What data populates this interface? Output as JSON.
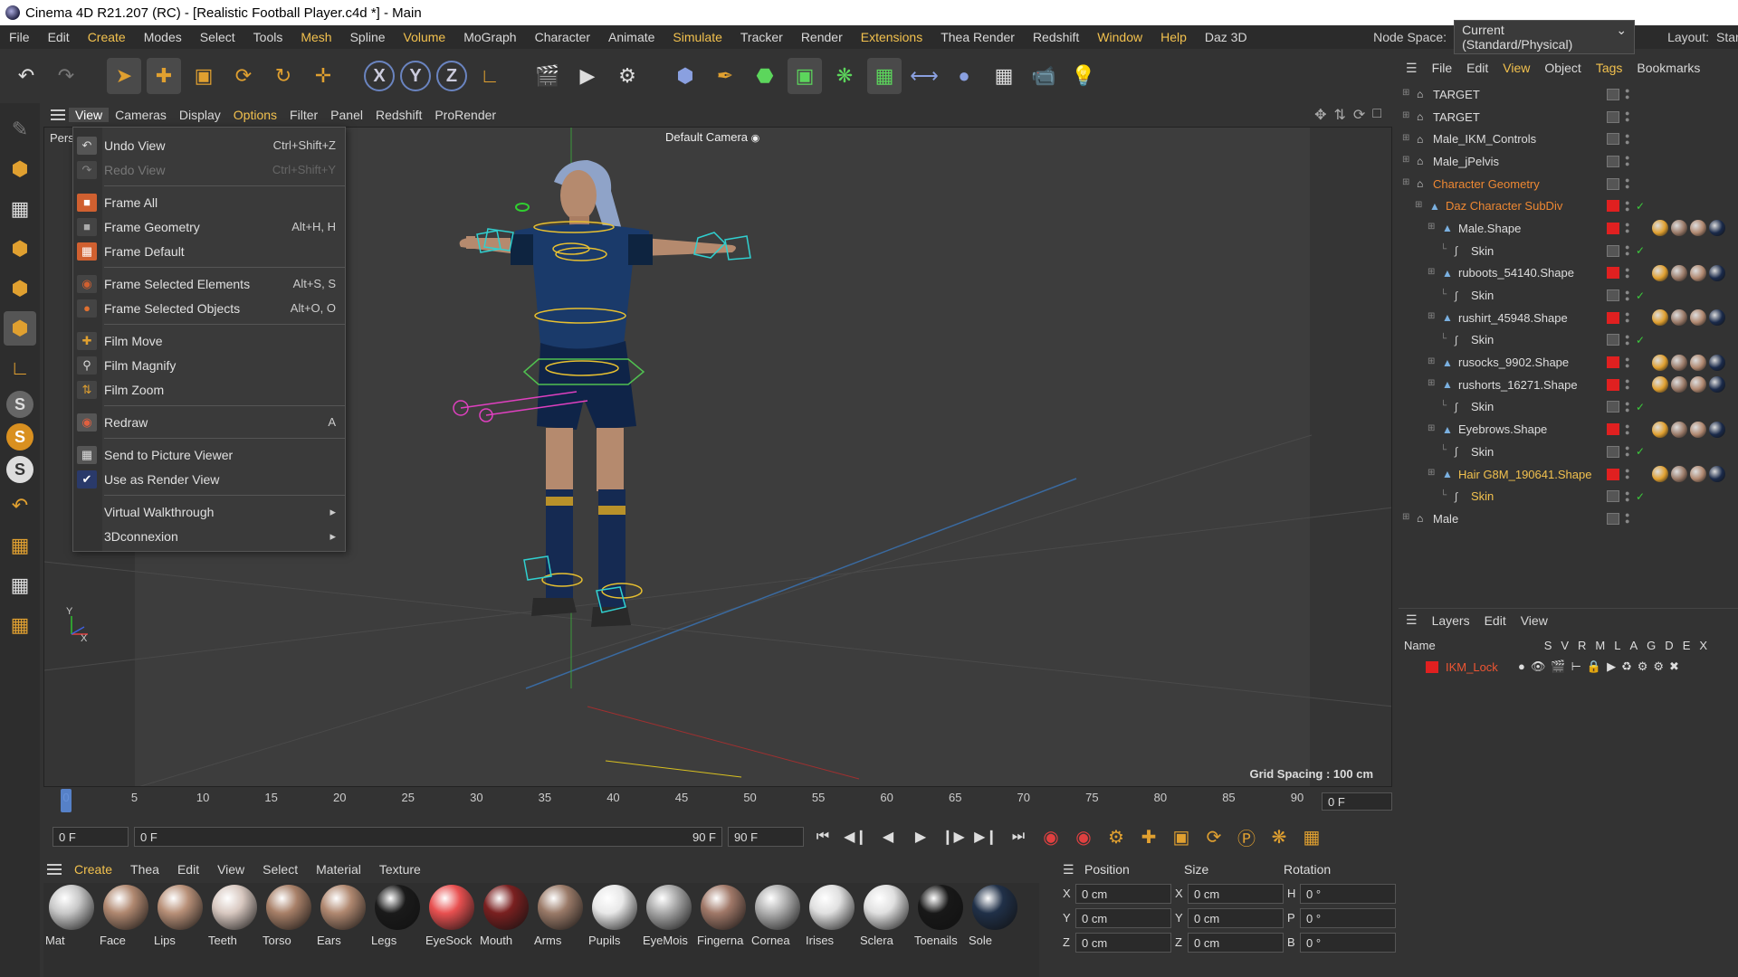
{
  "window": {
    "title": "Cinema 4D R21.207 (RC) - [Realistic Football Player.c4d *] - Main"
  },
  "menubar": {
    "items": [
      {
        "label": "File",
        "hl": false
      },
      {
        "label": "Edit",
        "hl": false
      },
      {
        "label": "Create",
        "hl": true
      },
      {
        "label": "Modes",
        "hl": false
      },
      {
        "label": "Select",
        "hl": false
      },
      {
        "label": "Tools",
        "hl": false
      },
      {
        "label": "Mesh",
        "hl": true
      },
      {
        "label": "Spline",
        "hl": false
      },
      {
        "label": "Volume",
        "hl": true
      },
      {
        "label": "MoGraph",
        "hl": false
      },
      {
        "label": "Character",
        "hl": false
      },
      {
        "label": "Animate",
        "hl": false
      },
      {
        "label": "Simulate",
        "hl": true
      },
      {
        "label": "Tracker",
        "hl": false
      },
      {
        "label": "Render",
        "hl": false
      },
      {
        "label": "Extensions",
        "hl": true
      },
      {
        "label": "Thea Render",
        "hl": false
      },
      {
        "label": "Redshift",
        "hl": false
      },
      {
        "label": "Window",
        "hl": true
      },
      {
        "label": "Help",
        "hl": true
      },
      {
        "label": "Daz 3D",
        "hl": false
      }
    ],
    "node_space_label": "Node Space:",
    "node_space_value": "Current (Standard/Physical)",
    "layout_label": "Layout:",
    "layout_value": "Start"
  },
  "toolbar": {
    "undo_icon": "undo-icon",
    "axis_x": "X",
    "axis_y": "Y",
    "axis_z": "Z"
  },
  "viewport": {
    "menu": [
      {
        "label": "View",
        "active": true
      },
      {
        "label": "Cameras"
      },
      {
        "label": "Display"
      },
      {
        "label": "Options",
        "hl": true
      },
      {
        "label": "Filter"
      },
      {
        "label": "Panel"
      },
      {
        "label": "Redshift"
      },
      {
        "label": "ProRender"
      }
    ],
    "persp_label": "Pers",
    "camera_label": "Default Camera",
    "grid_spacing": "Grid Spacing : 100 cm"
  },
  "view_menu": {
    "items": [
      {
        "label": "Undo View",
        "shortcut": "Ctrl+Shift+Z",
        "icon": "undo-view-icon",
        "disabled": false
      },
      {
        "label": "Redo View",
        "shortcut": "Ctrl+Shift+Y",
        "icon": "redo-view-icon",
        "disabled": true
      },
      {
        "sep": true
      },
      {
        "label": "Frame All",
        "shortcut": "",
        "icon": "frame-all-icon"
      },
      {
        "label": "Frame Geometry",
        "shortcut": "Alt+H, H",
        "icon": "frame-geometry-icon"
      },
      {
        "label": "Frame Default",
        "shortcut": "",
        "icon": "frame-default-icon"
      },
      {
        "sep": true
      },
      {
        "label": "Frame Selected Elements",
        "shortcut": "Alt+S, S",
        "icon": "frame-selected-elements-icon"
      },
      {
        "label": "Frame Selected Objects",
        "shortcut": "Alt+O, O",
        "icon": "frame-selected-objects-icon"
      },
      {
        "sep": true
      },
      {
        "label": "Film Move",
        "shortcut": "",
        "icon": "film-move-icon"
      },
      {
        "label": "Film Magnify",
        "shortcut": "",
        "icon": "film-magnify-icon"
      },
      {
        "label": "Film Zoom",
        "shortcut": "",
        "icon": "film-zoom-icon"
      },
      {
        "sep": true
      },
      {
        "label": "Redraw",
        "shortcut": "A",
        "icon": "redraw-icon"
      },
      {
        "sep": true
      },
      {
        "label": "Send to Picture Viewer",
        "shortcut": "",
        "icon": "picture-viewer-icon"
      },
      {
        "label": "Use as Render View",
        "shortcut": "",
        "icon": "checkbox-icon"
      },
      {
        "sep": true
      },
      {
        "label": "Virtual Walkthrough",
        "shortcut": "",
        "icon": "",
        "submenu": true
      },
      {
        "label": "3Dconnexion",
        "shortcut": "",
        "icon": "",
        "submenu": true
      }
    ]
  },
  "timeline": {
    "ticks": [
      "0",
      "5",
      "10",
      "15",
      "20",
      "25",
      "30",
      "35",
      "40",
      "45",
      "50",
      "55",
      "60",
      "65",
      "70",
      "75",
      "80",
      "85",
      "90"
    ],
    "current_frame": "0 F"
  },
  "transport": {
    "start_field": "0 F",
    "range_start": "0 F",
    "range_end": "90 F",
    "end_field": "90 F"
  },
  "material_manager": {
    "menu": [
      {
        "label": "Create",
        "hl": true
      },
      {
        "label": "Thea"
      },
      {
        "label": "Edit"
      },
      {
        "label": "View"
      },
      {
        "label": "Select"
      },
      {
        "label": "Material"
      },
      {
        "label": "Texture"
      }
    ],
    "materials": [
      {
        "label": "Mat",
        "color": "#c8c8c8"
      },
      {
        "label": "Face",
        "color": "#b08870"
      },
      {
        "label": "Lips",
        "color": "#b89078"
      },
      {
        "label": "Teeth",
        "color": "#d8c8c0"
      },
      {
        "label": "Torso",
        "color": "#a88068"
      },
      {
        "label": "Ears",
        "color": "#b08870"
      },
      {
        "label": "Legs",
        "color": "#1a1a1a"
      },
      {
        "label": "EyeSock",
        "color": "#e85050"
      },
      {
        "label": "Mouth",
        "color": "#7a2020"
      },
      {
        "label": "Arms",
        "color": "#9a7a68"
      },
      {
        "label": "Pupils",
        "color": "#e8e8e8"
      },
      {
        "label": "EyeMois",
        "color": "#a8a8a8"
      },
      {
        "label": "Fingerna",
        "color": "#a07868"
      },
      {
        "label": "Cornea",
        "color": "#b0b0b0"
      },
      {
        "label": "Irises",
        "color": "#e0e0e0"
      },
      {
        "label": "Sclera",
        "color": "#e0e0e0"
      },
      {
        "label": "Toenails",
        "color": "#181818"
      },
      {
        "label": "Sole",
        "color": "#203048"
      }
    ]
  },
  "coordinates": {
    "headers": [
      "Position",
      "Size",
      "Rotation"
    ],
    "rows": [
      {
        "axis": "X",
        "pos": "0 cm",
        "size_axis": "X",
        "size": "0 cm",
        "rot_axis": "H",
        "rot": "0 °"
      },
      {
        "axis": "Y",
        "pos": "0 cm",
        "size_axis": "Y",
        "size": "0 cm",
        "rot_axis": "P",
        "rot": "0 °"
      },
      {
        "axis": "Z",
        "pos": "0 cm",
        "size_axis": "Z",
        "size": "0 cm",
        "rot_axis": "B",
        "rot": "0 °"
      }
    ]
  },
  "object_manager": {
    "menu": [
      {
        "label": "File"
      },
      {
        "label": "Edit"
      },
      {
        "label": "View",
        "hl": true
      },
      {
        "label": "Object"
      },
      {
        "label": "Tags",
        "hl": true
      },
      {
        "label": "Bookmarks"
      }
    ],
    "objects": [
      {
        "name": "TARGET",
        "depth": 0,
        "flag": "grey",
        "style": ""
      },
      {
        "name": "TARGET",
        "depth": 0,
        "flag": "grey",
        "style": ""
      },
      {
        "name": "Male_IKM_Controls",
        "depth": 0,
        "flag": "grey",
        "style": ""
      },
      {
        "name": "Male_jPelvis",
        "depth": 0,
        "flag": "grey",
        "style": ""
      },
      {
        "name": "Character Geometry",
        "depth": 0,
        "flag": "grey",
        "style": "or"
      },
      {
        "name": "Daz Character SubDiv",
        "depth": 1,
        "flag": "red",
        "style": "or"
      },
      {
        "name": "Male.Shape",
        "depth": 2,
        "flag": "red",
        "style": ""
      },
      {
        "name": "Skin",
        "depth": 3,
        "flag": "grey",
        "style": ""
      },
      {
        "name": "ruboots_54140.Shape",
        "depth": 2,
        "flag": "red",
        "style": ""
      },
      {
        "name": "Skin",
        "depth": 3,
        "flag": "grey",
        "style": ""
      },
      {
        "name": "rushirt_45948.Shape",
        "depth": 2,
        "flag": "red",
        "style": ""
      },
      {
        "name": "Skin",
        "depth": 3,
        "flag": "grey",
        "style": ""
      },
      {
        "name": "rusocks_9902.Shape",
        "depth": 2,
        "flag": "red",
        "style": ""
      },
      {
        "name": "rushorts_16271.Shape",
        "depth": 2,
        "flag": "red",
        "style": ""
      },
      {
        "name": "Skin",
        "depth": 3,
        "flag": "grey",
        "style": ""
      },
      {
        "name": "Eyebrows.Shape",
        "depth": 2,
        "flag": "red",
        "style": ""
      },
      {
        "name": "Skin",
        "depth": 3,
        "flag": "grey",
        "style": ""
      },
      {
        "name": "Hair G8M_190641.Shape",
        "depth": 2,
        "flag": "red",
        "style": "hl"
      },
      {
        "name": "Skin",
        "depth": 3,
        "flag": "grey",
        "style": "hl"
      },
      {
        "name": "Male",
        "depth": 0,
        "flag": "grey",
        "style": ""
      }
    ]
  },
  "layers": {
    "menu": [
      "Layers",
      "Edit",
      "View"
    ],
    "columns": [
      "Name",
      "S",
      "V",
      "R",
      "M",
      "L",
      "A",
      "G",
      "D",
      "E",
      "X"
    ],
    "rows": [
      {
        "name": "IKM_Lock",
        "color": "#e02020"
      }
    ]
  }
}
